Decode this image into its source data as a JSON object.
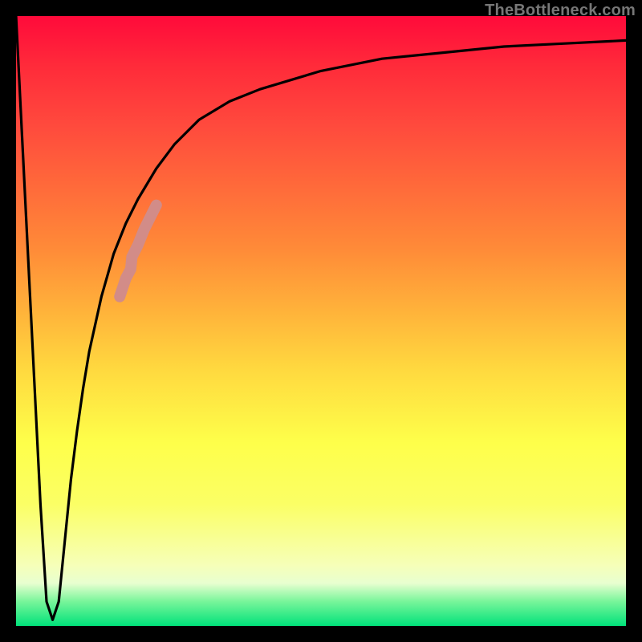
{
  "watermark": "TheBottleneck.com",
  "chart_data": {
    "type": "line",
    "title": "",
    "xlabel": "",
    "ylabel": "",
    "xlim": [
      0,
      100
    ],
    "ylim": [
      0,
      100
    ],
    "grid": false,
    "legend": false,
    "series": [
      {
        "name": "bottleneck-curve",
        "x": [
          0,
          1,
          2,
          3,
          4,
          5,
          6,
          7,
          8,
          9,
          10,
          11,
          12,
          14,
          16,
          18,
          20,
          23,
          26,
          30,
          35,
          40,
          50,
          60,
          70,
          80,
          90,
          100
        ],
        "y": [
          100,
          80,
          60,
          40,
          20,
          4,
          1,
          4,
          14,
          24,
          32,
          39,
          45,
          54,
          61,
          66,
          70,
          75,
          79,
          83,
          86,
          88,
          91,
          93,
          94,
          95,
          95.5,
          96
        ]
      }
    ],
    "highlight": {
      "name": "highlighted-range",
      "color": "#d28c88",
      "x": [
        17.0,
        17.5,
        18.0,
        18.8,
        19.0,
        20.0,
        21.0,
        22.0,
        23.0
      ],
      "y": [
        54.0,
        55.5,
        57.0,
        58.5,
        60.5,
        62.5,
        65.0,
        67.0,
        69.0
      ]
    }
  }
}
